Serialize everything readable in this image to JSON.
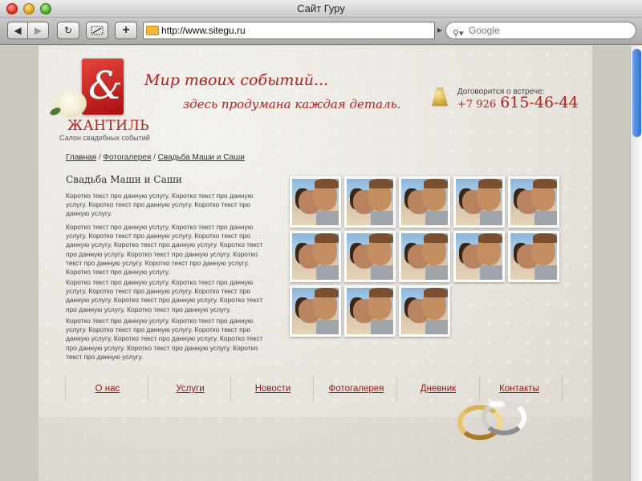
{
  "window": {
    "title": "Сайт Гуру"
  },
  "toolbar": {
    "url": "http://www.sitegu.ru",
    "search_placeholder": "Google",
    "back": "◀",
    "forward": "▶",
    "reload": "↻",
    "add": "+"
  },
  "site": {
    "brand": "ЖАНТИЛЬ",
    "tagline": "Салон свадебных событий",
    "logo_glyph": "&",
    "slogan_line1": "Мир твоих событий...",
    "slogan_line2": "здесь продумана каждая деталь.",
    "contact_label": "Договорится о встрече:",
    "phone_code": "+7 926",
    "phone_number": "615-46-44"
  },
  "breadcrumb": {
    "items": [
      "Главная",
      "Фотогалерея",
      "Свадьба Маши и Саши"
    ],
    "separator": " / "
  },
  "article": {
    "title": "Свадьба Маши и Саши",
    "paragraphs": [
      "Коротко текст про данную услугу.  Коротко текст про данную услугу. Коротко текст про данную услугу.  Коротко текст про данную услугу.",
      "Коротко текст про данную услугу.  Коротко текст про данную услугу. Коротко текст про данную услугу.  Коротко текст про данную услугу. Коротко текст про данную услугу. Коротко текст про данную услугу.  Коротко текст про данную услугу. Коротко текст про данную услугу.  Коротко текст про данную услугу. Коротко текст про данную услугу.",
      "Коротко текст про данную услугу.  Коротко текст про данную услугу. Коротко текст про данную услугу.  Коротко текст про данную услугу.  Коротко текст про данную услугу. Коротко текст про данную услугу.  Коротко текст про данную услугу.",
      "Коротко текст про данную услугу.  Коротко текст про данную услугу. Коротко текст про данную услугу.  Коротко текст про данную услугу. Коротко текст про данную услугу. Коротко текст про данную услугу.  Коротко текст про данную услугу.  Коротко текст про данную услугу."
    ]
  },
  "gallery": {
    "rows": [
      5,
      5,
      3
    ]
  },
  "nav": {
    "items": [
      "О нас",
      "Услуги",
      "Новости",
      "Фотогалерея",
      "Дневник",
      "Контакты"
    ]
  },
  "colors": {
    "accent": "#b5201a",
    "link": "#9a1511"
  },
  "icons": {
    "bell": "bell-icon",
    "rings": "wedding-rings-icon",
    "search": "search-icon",
    "folder": "folder-icon"
  }
}
